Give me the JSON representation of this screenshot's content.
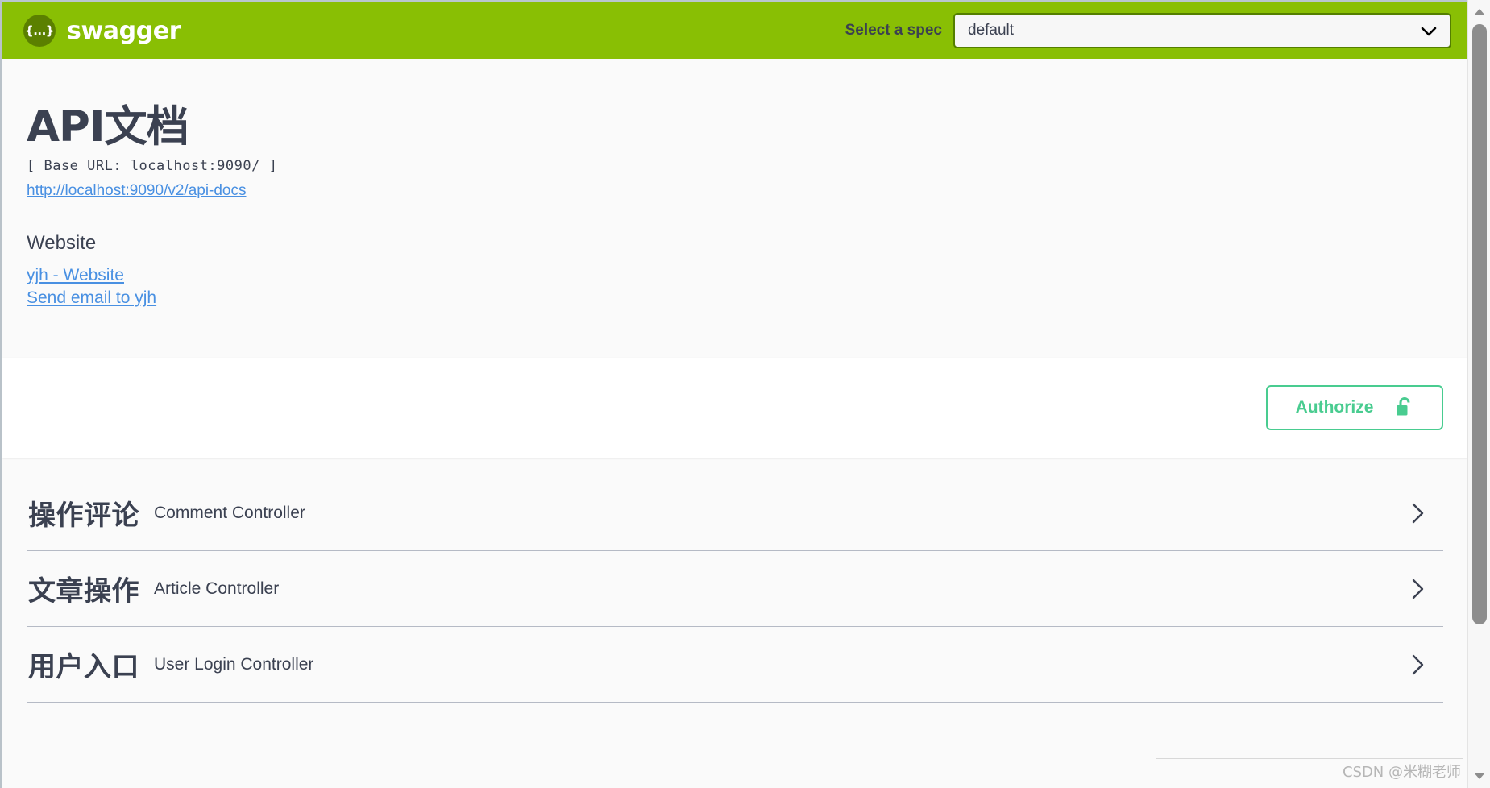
{
  "colors": {
    "brand_green": "#89bf04",
    "logo_circle": "#5b8000",
    "select_border": "#547f00",
    "authorize_green": "#49cc90",
    "link_blue": "#4990e2",
    "text_dark": "#3b4151",
    "info_background": "#fafafa"
  },
  "topbar": {
    "logo_text": "swagger",
    "logo_mark": "{...}",
    "logo_icon_name": "swagger-braces-icon",
    "spec_label": "Select a spec",
    "spec_selected": "default",
    "spec_options": [
      "default"
    ],
    "chevron_icon": "chevron-down-icon"
  },
  "info": {
    "title": "API文档",
    "base_url": "[ Base URL: localhost:9090/ ]",
    "docs_link": "http://localhost:9090/v2/api-docs",
    "section_title": "Website",
    "contact_links": [
      "yjh - Website",
      "Send email to yjh"
    ]
  },
  "auth": {
    "authorize_label": "Authorize",
    "lock_icon": "unlocked-padlock-icon",
    "locked": false
  },
  "tags": [
    {
      "name": "操作评论",
      "description": "Comment Controller",
      "arrow_icon": "chevron-right-icon",
      "expanded": false
    },
    {
      "name": "文章操作",
      "description": "Article Controller",
      "arrow_icon": "chevron-right-icon",
      "expanded": false
    },
    {
      "name": "用户入口",
      "description": "User Login Controller",
      "arrow_icon": "chevron-right-icon",
      "expanded": false
    }
  ],
  "watermark": "CSDN @米糊老师",
  "scrollbar": {
    "up_icon": "scroll-up-arrow-icon",
    "down_icon": "scroll-down-arrow-icon"
  }
}
